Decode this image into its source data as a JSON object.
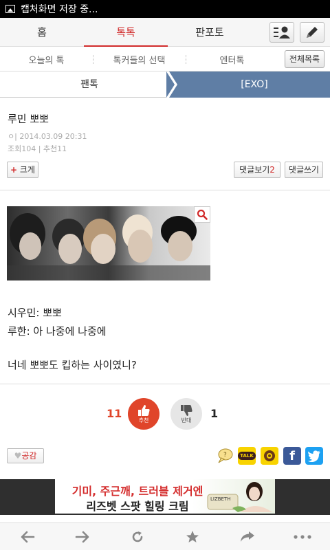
{
  "status_bar": {
    "text": "캡처화면 저장 중..."
  },
  "top_nav": {
    "tabs": [
      "홈",
      "톡톡",
      "판포토"
    ],
    "active_index": 1
  },
  "sub_nav": {
    "items": [
      "오늘의 톡",
      "톡커들의 선택",
      "엔터톡"
    ],
    "all_button": "전체목록"
  },
  "breadcrumb": {
    "left": "팬톡",
    "right": "[EXO]"
  },
  "post": {
    "title": "루민 뽀뽀",
    "date_line": "ㅇ| 2014.03.09 20:31",
    "stats_line": "조회104 | 추천11",
    "big_button": "크게",
    "big_button_plus": "+",
    "comments_view_label": "댓글보기",
    "comments_count": "2",
    "comment_write_label": "댓글쓰기",
    "body_lines": [
      "시우민: 뽀뽀",
      "루한: 아 나중에 나중에",
      "너네 뽀뽀도 킵하는 사이였니?"
    ]
  },
  "votes": {
    "up_count": "11",
    "up_label": "추천",
    "down_count": "1",
    "down_label": "반대"
  },
  "empathy": {
    "label": "공감"
  },
  "share_icons": [
    "yellow-speech-icon",
    "kakaotalk-icon",
    "kakaostory-icon",
    "facebook-icon",
    "twitter-icon"
  ],
  "share_text": {
    "talk": "TALK",
    "facebook": "f"
  },
  "ad": {
    "line1": "기미, 주근깨, 트러블 제거엔",
    "line2": "리즈벳 스팟 힐링 크림",
    "product": "LIZBETH"
  },
  "colors": {
    "accent": "#d12a2a",
    "breadcrumb_active": "#5f7ea5",
    "up_vote": "#e0452a",
    "facebook": "#3b5998",
    "twitter": "#1da1f2",
    "kakao": "#f8d300"
  }
}
